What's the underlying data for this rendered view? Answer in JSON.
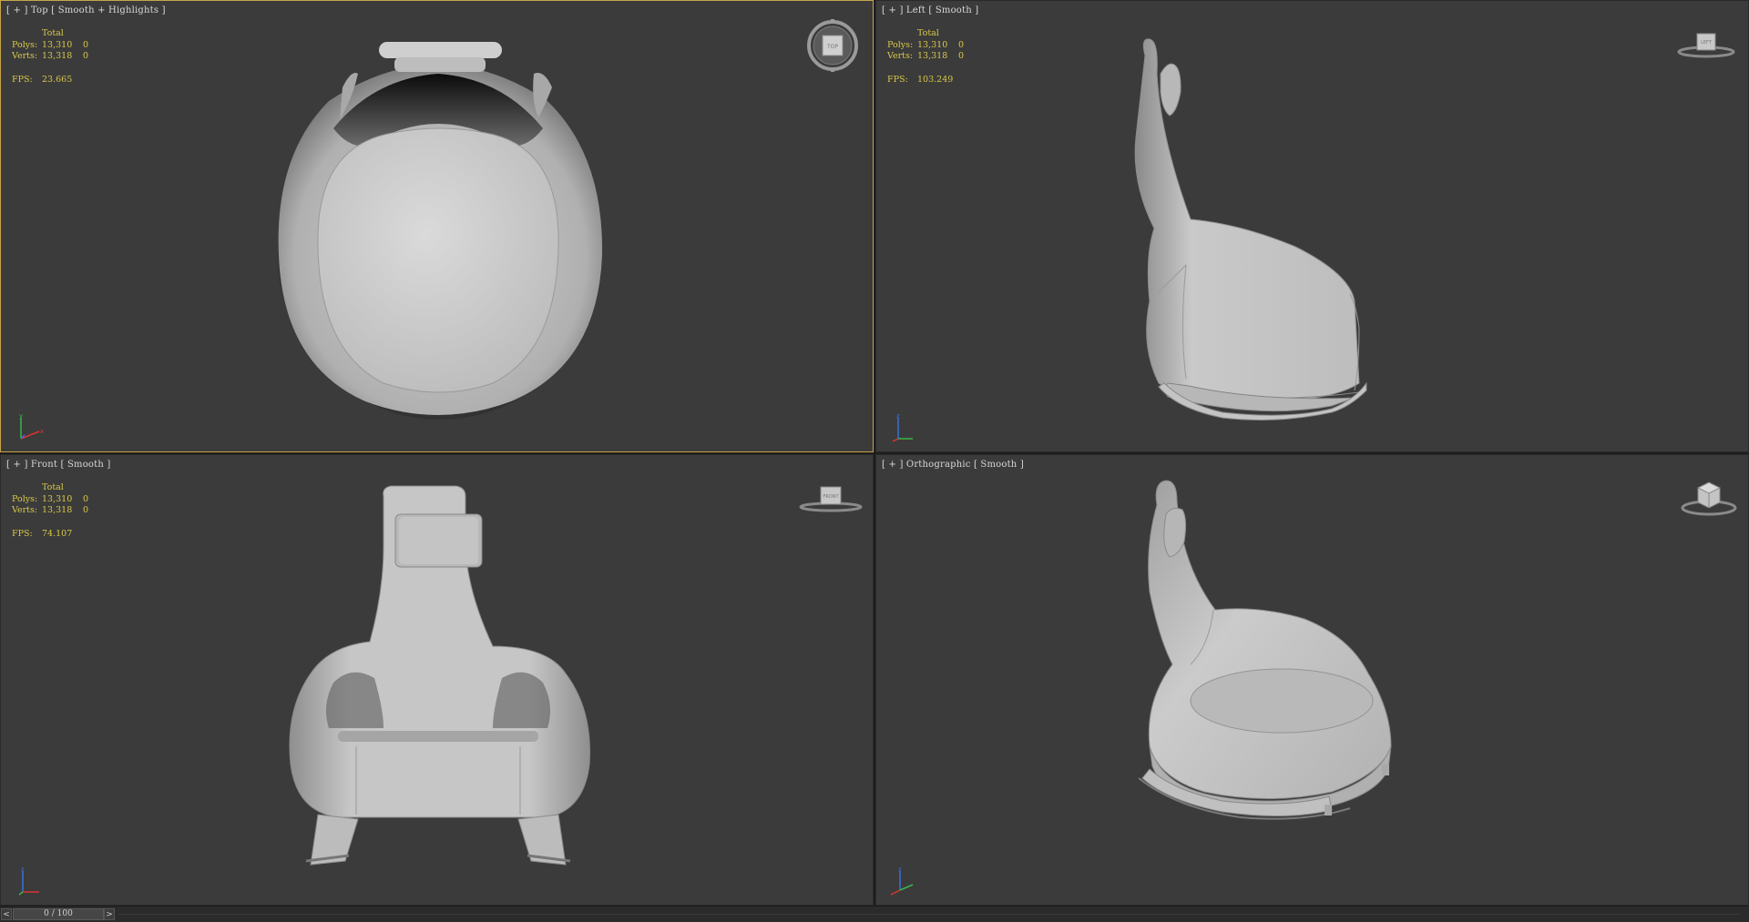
{
  "viewports": [
    {
      "id": "top",
      "label_parts": [
        "[ + ]",
        "Top",
        "Smooth + Highlights ]"
      ],
      "label_text": "[ + ] Top [ Smooth + Highlights ]",
      "stats": {
        "header": "Total",
        "polys_label": "Polys:",
        "polys_value": "13,310",
        "polys_sel": "0",
        "verts_label": "Verts:",
        "verts_value": "13,318",
        "verts_sel": "0",
        "fps_label": "FPS:",
        "fps_value": "23.665"
      },
      "viewcube_label": "TOP",
      "active": true
    },
    {
      "id": "left",
      "label_text": "[ + ] Left [ Smooth ]",
      "stats": {
        "header": "Total",
        "polys_label": "Polys:",
        "polys_value": "13,310",
        "polys_sel": "0",
        "verts_label": "Verts:",
        "verts_value": "13,318",
        "verts_sel": "0",
        "fps_label": "FPS:",
        "fps_value": "103.249"
      },
      "viewcube_label": "LEFT",
      "active": false
    },
    {
      "id": "front",
      "label_text": "[ + ] Front [ Smooth ]",
      "stats": {
        "header": "Total",
        "polys_label": "Polys:",
        "polys_value": "13,310",
        "polys_sel": "0",
        "verts_label": "Verts:",
        "verts_value": "13,318",
        "verts_sel": "0",
        "fps_label": "FPS:",
        "fps_value": "74.107"
      },
      "viewcube_label": "FRONT",
      "active": false
    },
    {
      "id": "orthographic",
      "label_text": "[ + ] Orthographic [ Smooth ]",
      "stats": null,
      "viewcube_label": "",
      "active": false
    }
  ],
  "timeline": {
    "prev": "<",
    "slider_text": "0 / 100",
    "next": ">"
  },
  "colors": {
    "viewport_bg": "#3b3b3b",
    "active_border": "#c9a54a",
    "stats_text": "#d9c84a",
    "model": "#bdbdbd"
  }
}
